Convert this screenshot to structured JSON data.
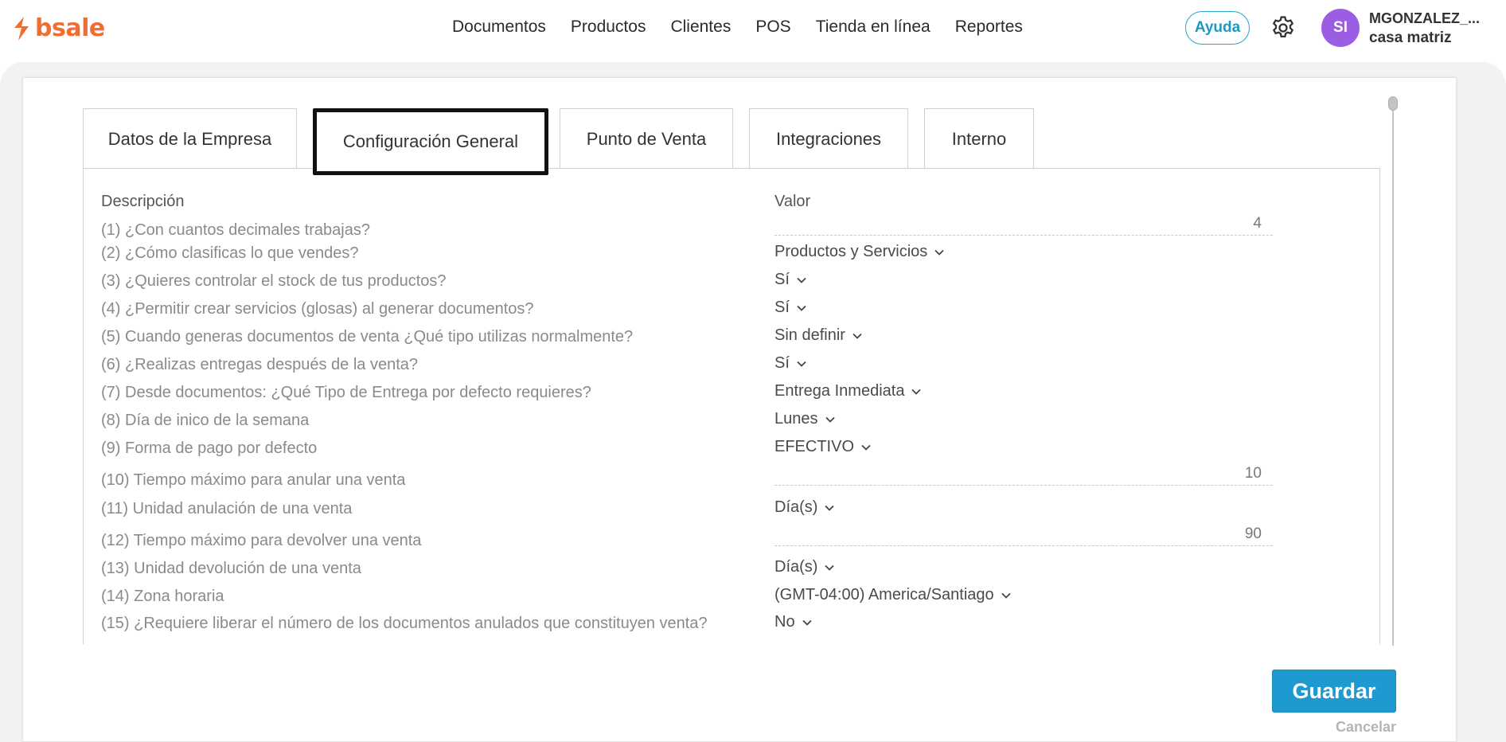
{
  "brand": {
    "name": "bsale",
    "color": "#f36c32"
  },
  "nav": {
    "items": [
      {
        "label": "Documentos"
      },
      {
        "label": "Productos"
      },
      {
        "label": "Clientes"
      },
      {
        "label": "POS"
      },
      {
        "label": "Tienda en línea"
      },
      {
        "label": "Reportes"
      }
    ]
  },
  "header": {
    "help_label": "Ayuda",
    "avatar_initials": "SI",
    "user_name": "MGONZALEZ_...",
    "branch": "casa matriz"
  },
  "tabs": [
    {
      "label": "Datos de la Empresa",
      "active": false
    },
    {
      "label": "Configuración General",
      "active": true
    },
    {
      "label": "Punto de Venta",
      "active": false
    },
    {
      "label": "Integraciones",
      "active": false
    },
    {
      "label": "Interno",
      "active": false
    }
  ],
  "table": {
    "col_description": "Descripción",
    "col_value": "Valor",
    "rows": [
      {
        "desc": "(1) ¿Con cuantos decimales trabajas?",
        "type": "input",
        "value": "4"
      },
      {
        "desc": "(2) ¿Cómo clasificas lo que vendes?",
        "type": "select",
        "value": "Productos y Servicios"
      },
      {
        "desc": "(3) ¿Quieres controlar el stock de tus productos?",
        "type": "select",
        "value": "Sí"
      },
      {
        "desc": "(4) ¿Permitir crear servicios (glosas) al generar documentos?",
        "type": "select",
        "value": "Sí"
      },
      {
        "desc": "(5) Cuando generas documentos de venta ¿Qué tipo utilizas normalmente?",
        "type": "select",
        "value": "Sin definir"
      },
      {
        "desc": "(6) ¿Realizas entregas después de la venta?",
        "type": "select",
        "value": "Sí"
      },
      {
        "desc": "(7) Desde documentos: ¿Qué Tipo de Entrega por defecto requieres?",
        "type": "select",
        "value": "Entrega Inmediata"
      },
      {
        "desc": "(8) Día de inico de la semana",
        "type": "select",
        "value": "Lunes"
      },
      {
        "desc": "(9) Forma de pago por defecto",
        "type": "select",
        "value": "EFECTIVO"
      },
      {
        "desc": "(10) Tiempo máximo para anular una venta",
        "type": "input",
        "value": "10"
      },
      {
        "desc": "(11) Unidad anulación de una venta",
        "type": "select",
        "value": "Día(s)"
      },
      {
        "desc": "(12) Tiempo máximo para devolver una venta",
        "type": "input",
        "value": "90"
      },
      {
        "desc": "(13) Unidad devolución de una venta",
        "type": "select",
        "value": "Día(s)"
      },
      {
        "desc": "(14) Zona horaria",
        "type": "select",
        "value": "(GMT-04:00) America/Santiago"
      },
      {
        "desc": "(15) ¿Requiere liberar el número de los documentos anulados que constituyen venta?",
        "type": "select",
        "value": "No"
      }
    ]
  },
  "footer": {
    "save_label": "Guardar",
    "cancel_label": "Cancelar",
    "save_color": "#1e9ad0"
  },
  "icons": {
    "logo": "bsale-logo-icon",
    "settings": "gear-icon",
    "chevron": "chevron-down-icon"
  }
}
